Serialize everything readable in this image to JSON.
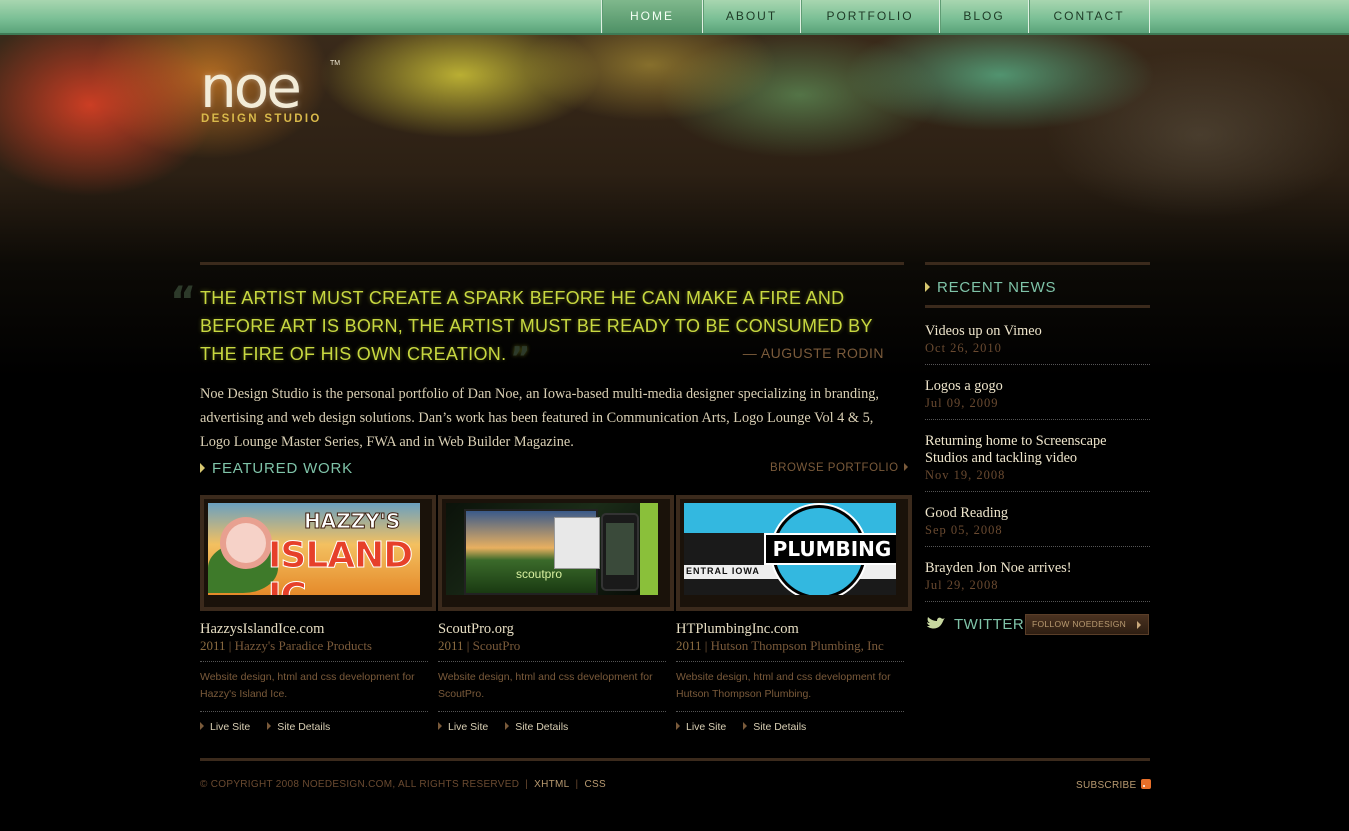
{
  "nav": {
    "items": [
      "HOME",
      "ABOUT",
      "PORTFOLIO",
      "BLOG",
      "CONTACT"
    ],
    "active": "HOME"
  },
  "logo": {
    "wordmark": "noe",
    "tm": "TM",
    "subtitle": "DESIGN STUDIO"
  },
  "quote": {
    "text": "THE ARTIST MUST CREATE A SPARK BEFORE HE CAN MAKE A FIRE AND BEFORE ART IS BORN, THE ARTIST MUST BE READY TO BE CONSUMED BY THE FIRE OF HIS OWN CREATION.",
    "author": "— AUGUSTE RODIN"
  },
  "intro": "Noe Design Studio is the personal portfolio of Dan Noe, an Iowa-based multi-media designer specializing in branding, advertising and web design solutions. Dan’s work has been featured in Communication Arts, Logo Lounge Vol 4 & 5, Logo Lounge Master Series, FWA and in Web Builder Magazine.",
  "featured": {
    "heading": "FEATURED WORK",
    "browse": "BROWSE PORTFOLIO",
    "works": [
      {
        "title": "HazzysIslandIce.com",
        "year": "2011",
        "client": "Hazzy's Paradice Products",
        "desc": "Website design, html and css development for Hazzy's Island Ice.",
        "live": "Live Site",
        "details": "Site Details",
        "thumb_text_top": "HAZZY'S",
        "thumb_text_main": "ISLAND IC"
      },
      {
        "title": "ScoutPro.org",
        "year": "2011",
        "client": "ScoutPro",
        "desc": "Website design, html and css development for ScoutPro.",
        "live": "Live Site",
        "details": "Site Details",
        "thumb_text_main": "scoutpro"
      },
      {
        "title": "HTPlumbingInc.com",
        "year": "2011",
        "client": "Hutson Thompson Plumbing, Inc",
        "desc": "Website design, html and css development for Hutson Thompson Plumbing.",
        "live": "Live Site",
        "details": "Site Details",
        "thumb_text_main": "PLUMBING",
        "thumb_text_left": "ENTRAL IOWA"
      }
    ]
  },
  "news": {
    "heading": "RECENT NEWS",
    "items": [
      {
        "title": "Videos up on Vimeo",
        "date": "Oct 26, 2010"
      },
      {
        "title": "Logos a gogo",
        "date": "Jul 09, 2009"
      },
      {
        "title": "Returning home to Screenscape Studios and tackling video",
        "date": "Nov 19, 2008"
      },
      {
        "title": "Good Reading",
        "date": "Sep 05, 2008"
      },
      {
        "title": "Brayden Jon Noe arrives!",
        "date": "Jul 29, 2008"
      }
    ]
  },
  "twitter": {
    "label": "TWITTER",
    "follow": "FOLLOW NOEDESIGN"
  },
  "footer": {
    "copyright": "© COPYRIGHT 2008 NOEDESIGN.COM, ALL RIGHTS RESERVED",
    "sep": "|",
    "xhtml": "XHTML",
    "css": "CSS",
    "subscribe": "SUBSCRIBE"
  },
  "colors": {
    "nav_bar": "#7cc096",
    "quote": "#c8d840",
    "section_head": "#7fc3a8",
    "muted_brown": "#7a5a3a"
  }
}
